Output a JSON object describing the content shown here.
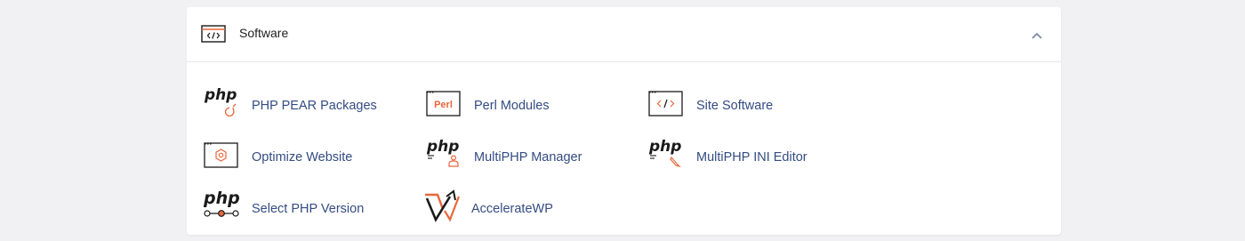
{
  "section": {
    "title": "Software",
    "header_icon": "code-window-icon",
    "collapse_icon": "chevron-up-icon"
  },
  "colors": {
    "accent": "#e8673c",
    "link": "#344c82",
    "icon_dark": "#1a1a1a"
  },
  "items": [
    {
      "label": "PHP PEAR Packages",
      "icon": "php-pear-icon"
    },
    {
      "label": "Perl Modules",
      "icon": "perl-icon",
      "icon_text": "Perl"
    },
    {
      "label": "Site Software",
      "icon": "code-window-icon"
    },
    {
      "label": "Optimize Website",
      "icon": "optimize-gear-icon"
    },
    {
      "label": "MultiPHP Manager",
      "icon": "php-user-icon"
    },
    {
      "label": "MultiPHP INI Editor",
      "icon": "php-edit-icon"
    },
    {
      "label": "Select PHP Version",
      "icon": "php-version-icon"
    },
    {
      "label": "AccelerateWP",
      "icon": "acceleratewp-icon"
    }
  ],
  "php_logo_text": "php"
}
